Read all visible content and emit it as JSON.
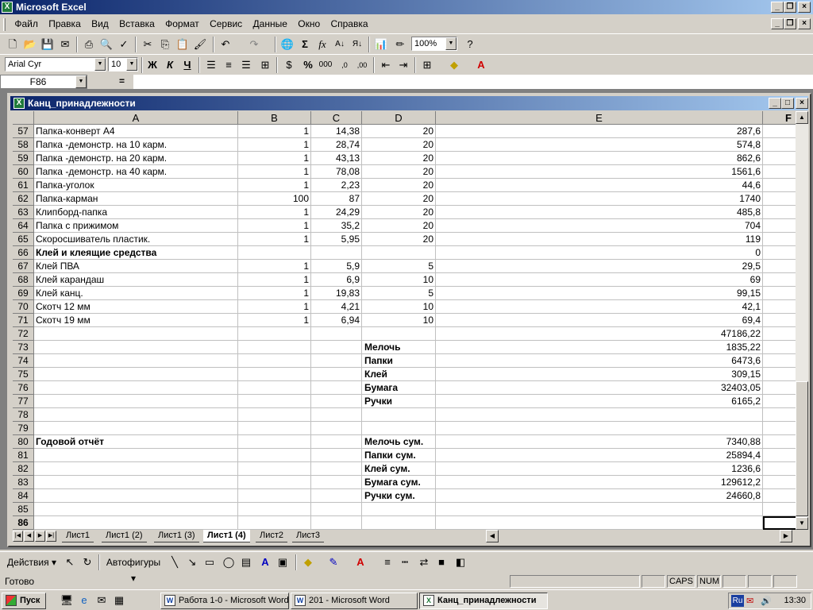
{
  "app": {
    "title": "Microsoft Excel",
    "icon": "excel-icon"
  },
  "menu": [
    "Файл",
    "Правка",
    "Вид",
    "Вставка",
    "Формат",
    "Сервис",
    "Данные",
    "Окно",
    "Справка"
  ],
  "toolbar": {
    "zoom": "100%",
    "font": "Arial Cyr",
    "size": "10"
  },
  "formula": {
    "cell_ref": "F86",
    "fx": "=",
    "content": ""
  },
  "book": {
    "title": "Канц_принадлежности"
  },
  "columns": [
    "A",
    "B",
    "C",
    "D",
    "E",
    "F"
  ],
  "rows": [
    {
      "n": "57",
      "a": "Папка-конверт А4",
      "b": "1",
      "c": "14,38",
      "d": "20",
      "dl": "",
      "e": "287,6"
    },
    {
      "n": "58",
      "a": "Папка -демонстр. на 10 карм.",
      "b": "1",
      "c": "28,74",
      "d": "20",
      "dl": "",
      "e": "574,8"
    },
    {
      "n": "59",
      "a": "Папка -демонстр. на 20 карм.",
      "b": "1",
      "c": "43,13",
      "d": "20",
      "dl": "",
      "e": "862,6"
    },
    {
      "n": "60",
      "a": "Папка -демонстр. на 40 карм.",
      "b": "1",
      "c": "78,08",
      "d": "20",
      "dl": "",
      "e": "1561,6"
    },
    {
      "n": "61",
      "a": "Папка-уголок",
      "b": "1",
      "c": "2,23",
      "d": "20",
      "dl": "",
      "e": "44,6"
    },
    {
      "n": "62",
      "a": "Папка-карман",
      "b": "100",
      "c": "87",
      "d": "20",
      "dl": "",
      "e": "1740"
    },
    {
      "n": "63",
      "a": "Клипборд-папка",
      "b": "1",
      "c": "24,29",
      "d": "20",
      "dl": "",
      "e": "485,8"
    },
    {
      "n": "64",
      "a": "Папка с прижимом",
      "b": "1",
      "c": "35,2",
      "d": "20",
      "dl": "",
      "e": "704"
    },
    {
      "n": "65",
      "a": "Скоросшиватель пластик.",
      "b": "1",
      "c": "5,95",
      "d": "20",
      "dl": "",
      "e": "119"
    },
    {
      "n": "66",
      "a": "Клей и клеящие средства",
      "b": "",
      "c": "",
      "d": "",
      "dl": "",
      "e": "0",
      "bold": true
    },
    {
      "n": "67",
      "a": "Клей ПВА",
      "b": "1",
      "c": "5,9",
      "d": "5",
      "dl": "",
      "e": "29,5"
    },
    {
      "n": "68",
      "a": "Клей карандаш",
      "b": "1",
      "c": "6,9",
      "d": "10",
      "dl": "",
      "e": "69"
    },
    {
      "n": "69",
      "a": "Клей канц.",
      "b": "1",
      "c": "19,83",
      "d": "5",
      "dl": "",
      "e": "99,15"
    },
    {
      "n": "70",
      "a": "Скотч 12 мм",
      "b": "1",
      "c": "4,21",
      "d": "10",
      "dl": "",
      "e": "42,1"
    },
    {
      "n": "71",
      "a": "Скотч 19 мм",
      "b": "1",
      "c": "6,94",
      "d": "10",
      "dl": "",
      "e": "69,4"
    },
    {
      "n": "72",
      "a": "",
      "b": "",
      "c": "",
      "d": "",
      "dl": "",
      "e": "47186,22"
    },
    {
      "n": "73",
      "a": "",
      "b": "",
      "c": "",
      "d": "",
      "dl": "Мелочь",
      "e": "1835,22"
    },
    {
      "n": "74",
      "a": "",
      "b": "",
      "c": "",
      "d": "",
      "dl": "Папки",
      "e": "6473,6"
    },
    {
      "n": "75",
      "a": "",
      "b": "",
      "c": "",
      "d": "",
      "dl": "Клей",
      "e": "309,15"
    },
    {
      "n": "76",
      "a": "",
      "b": "",
      "c": "",
      "d": "",
      "dl": "Бумага",
      "e": "32403,05"
    },
    {
      "n": "77",
      "a": "",
      "b": "",
      "c": "",
      "d": "",
      "dl": "Ручки",
      "e": "6165,2"
    },
    {
      "n": "78",
      "a": "",
      "b": "",
      "c": "",
      "d": "",
      "dl": "",
      "e": ""
    },
    {
      "n": "79",
      "a": "",
      "b": "",
      "c": "",
      "d": "",
      "dl": "",
      "e": ""
    },
    {
      "n": "80",
      "a": "Годовой отчёт",
      "b": "",
      "c": "",
      "d": "",
      "dl": "Мелочь сум.",
      "e": "7340,88",
      "bold": true
    },
    {
      "n": "81",
      "a": "",
      "b": "",
      "c": "",
      "d": "",
      "dl": "Папки сум.",
      "e": "25894,4"
    },
    {
      "n": "82",
      "a": "",
      "b": "",
      "c": "",
      "d": "",
      "dl": "Клей сум.",
      "e": "1236,6"
    },
    {
      "n": "83",
      "a": "",
      "b": "",
      "c": "",
      "d": "",
      "dl": "Бумага сум.",
      "e": "129612,2"
    },
    {
      "n": "84",
      "a": "",
      "b": "",
      "c": "",
      "d": "",
      "dl": "Ручки сум.",
      "e": "24660,8"
    },
    {
      "n": "85",
      "a": "",
      "b": "",
      "c": "",
      "d": "",
      "dl": "",
      "e": ""
    },
    {
      "n": "86",
      "a": "",
      "b": "",
      "c": "",
      "d": "",
      "dl": "",
      "e": ""
    }
  ],
  "sheets": [
    "Лист1",
    "Лист1 (2)",
    "Лист1 (3)",
    "Лист1 (4)",
    "Лист2",
    "Лист3"
  ],
  "active_sheet": "Лист1 (4)",
  "drawing": {
    "actions": "Действия",
    "autoshapes": "Автофигуры"
  },
  "status": {
    "text": "Готово",
    "caps": "CAPS",
    "num": "NUM"
  },
  "taskbar": {
    "start": "Пуск",
    "tasks": [
      "Работа 1-0 - Microsoft Word",
      "201 - Microsoft Word",
      "Канц_принадлежности"
    ],
    "lang": "Ru",
    "clock": "13:30"
  }
}
